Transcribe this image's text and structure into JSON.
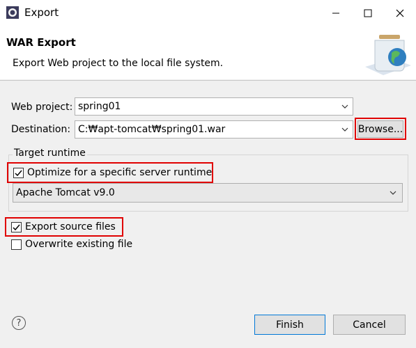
{
  "window": {
    "title": "Export"
  },
  "header": {
    "title": "WAR Export",
    "description": "Export Web project to the local file system."
  },
  "form": {
    "web_project_label": "Web project:",
    "web_project_value": "spring01",
    "destination_label": "Destination:",
    "destination_value": "C:₩apt-tomcat₩spring01.war",
    "browse_label": "Browse...",
    "target_runtime_label": "Target runtime",
    "optimize_label": "Optimize for a specific server runtime",
    "optimize_checked": true,
    "runtime_value": "Apache Tomcat v9.0",
    "export_source_label": "Export source files",
    "export_source_checked": true,
    "overwrite_label": "Overwrite existing file",
    "overwrite_checked": false
  },
  "footer": {
    "help_glyph": "?",
    "finish_label": "Finish",
    "cancel_label": "Cancel"
  },
  "colors": {
    "highlight": "#e00000",
    "primary_border": "#0078d7"
  }
}
